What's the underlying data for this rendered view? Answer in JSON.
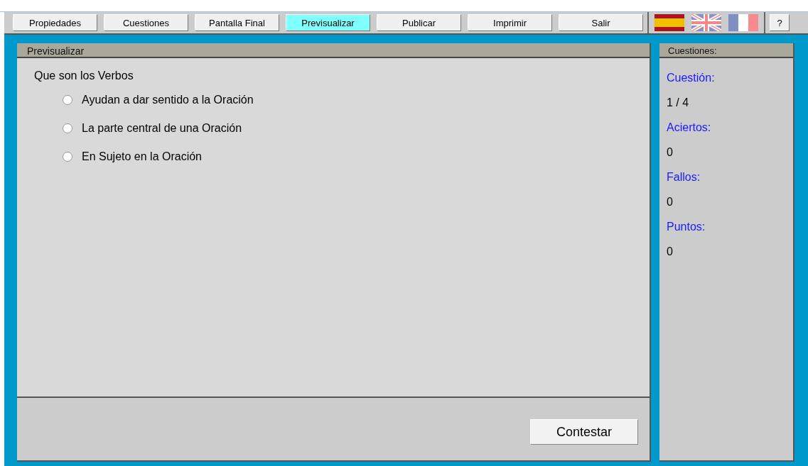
{
  "toolbar": {
    "buttons": [
      {
        "label": "Propiedades",
        "selected": false
      },
      {
        "label": "Cuestiones",
        "selected": false
      },
      {
        "label": "Pantalla Final",
        "selected": false
      },
      {
        "label": "Previsualizar",
        "selected": true
      },
      {
        "label": "Publicar",
        "selected": false
      },
      {
        "label": "Imprimir",
        "selected": false
      },
      {
        "label": "Salir",
        "selected": false
      }
    ],
    "flags": [
      {
        "kind": "es"
      },
      {
        "kind": "gb"
      },
      {
        "kind": "fr"
      }
    ],
    "help": "?"
  },
  "preview": {
    "title": "Previsualizar",
    "question": "Que son los Verbos",
    "options": [
      {
        "label": "Ayudan a dar sentido a la Oración",
        "selected": false
      },
      {
        "label": "La parte central de una Oración",
        "selected": false
      },
      {
        "label": "En Sujeto en la Oración",
        "selected": false
      }
    ],
    "submit": "Contestar"
  },
  "sidebar": {
    "title": "Cuestiones:",
    "stats": [
      {
        "label": "Cuestión:",
        "value": "1 / 4"
      },
      {
        "label": "Aciertos:",
        "value": "0"
      },
      {
        "label": "Fallos:",
        "value": "0"
      },
      {
        "label": "Puntos:",
        "value": "0"
      }
    ]
  }
}
